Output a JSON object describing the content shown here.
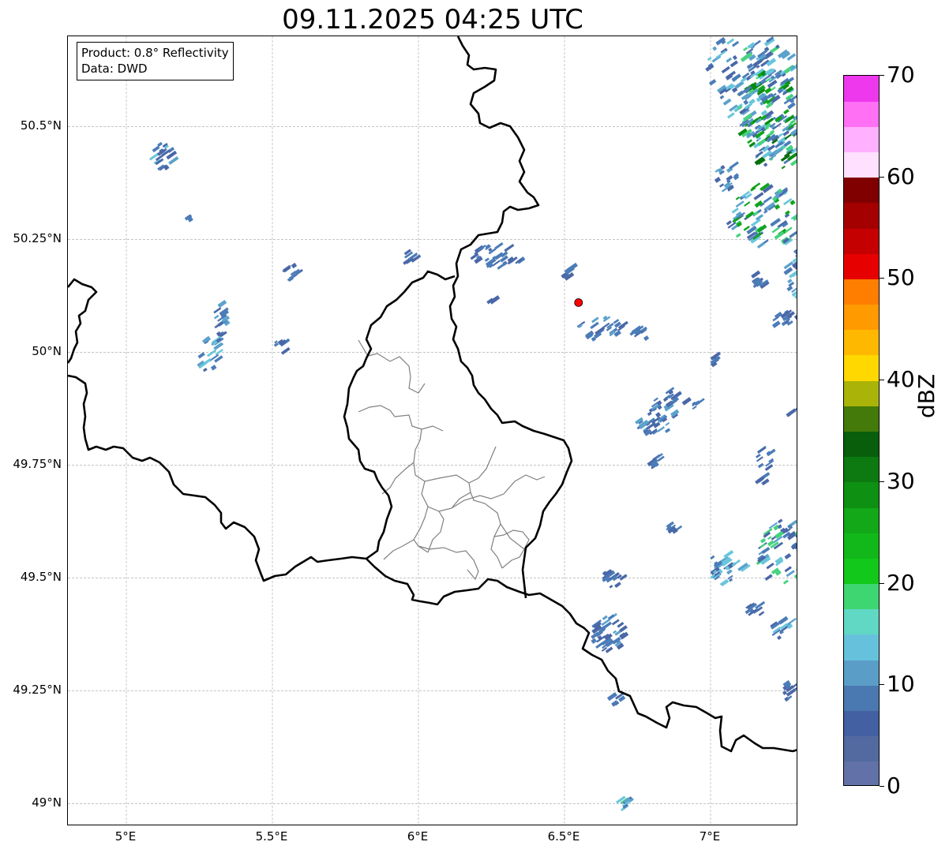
{
  "title": "09.11.2025 04:25 UTC",
  "info": {
    "product": "Product: 0.8° Reflectivity",
    "data_source": "Data: DWD"
  },
  "map": {
    "lon_range": [
      4.8,
      7.3
    ],
    "lat_range": [
      48.95,
      50.7
    ],
    "lon_ticks": [
      {
        "value": 5.0,
        "label": "5°E"
      },
      {
        "value": 5.5,
        "label": "5.5°E"
      },
      {
        "value": 6.0,
        "label": "6°E"
      },
      {
        "value": 6.5,
        "label": "6.5°E"
      },
      {
        "value": 7.0,
        "label": "7°E"
      }
    ],
    "lat_ticks": [
      {
        "value": 50.5,
        "label": "50.5°N"
      },
      {
        "value": 50.25,
        "label": "50.25°N"
      },
      {
        "value": 50.0,
        "label": "50°N"
      },
      {
        "value": 49.75,
        "label": "49.75°N"
      },
      {
        "value": 49.5,
        "label": "49.5°N"
      },
      {
        "value": 49.25,
        "label": "49.25°N"
      },
      {
        "value": 49.0,
        "label": "49°N"
      }
    ],
    "radar_site": {
      "lon": 6.548,
      "lat": 50.11,
      "color": "#ff0000"
    },
    "border_color": "#000000",
    "district_color": "#808080",
    "grid_color": "#b0b0b0"
  },
  "colorbar": {
    "label": "dBZ",
    "min": 0,
    "max": 70,
    "step": 2.5,
    "tick_labels": [
      "0",
      "10",
      "20",
      "30",
      "40",
      "50",
      "60",
      "70"
    ],
    "tick_values": [
      0,
      10,
      20,
      30,
      40,
      50,
      60,
      70
    ],
    "colors": [
      "#6272a8",
      "#526aa0",
      "#4260a2",
      "#4a78b0",
      "#5a9ec8",
      "#66c2dc",
      "#60d8c4",
      "#3ed670",
      "#12c81a",
      "#12b81a",
      "#12a818",
      "#0e9012",
      "#0c7a10",
      "#085e0a",
      "#447a0a",
      "#aab408",
      "#ffd800",
      "#ffb800",
      "#ff9a00",
      "#ff7e00",
      "#e60000",
      "#c40000",
      "#a40000",
      "#800000",
      "#ffe0ff",
      "#ffb0ff",
      "#ff70f4",
      "#ee38ee"
    ]
  },
  "precip_colors": [
    "#4a68a8",
    "#4b7cb8",
    "#5ba2cc",
    "#6ac6dc",
    "#46d27e",
    "#0fa51a",
    "#0b8a14",
    "#086c0e"
  ]
}
